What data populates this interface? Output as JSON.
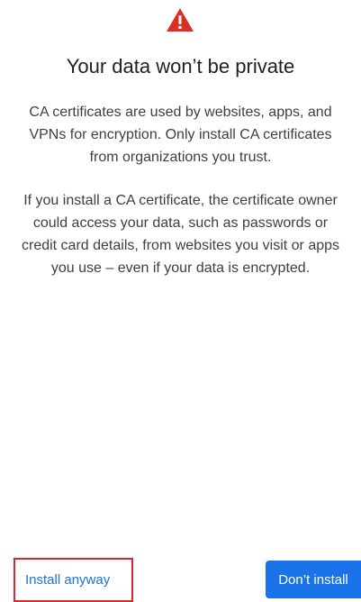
{
  "dialog": {
    "icon": "warning-triangle-icon",
    "title": "Your data won’t be private",
    "paragraph_1": "CA certificates are used by websites, apps, and VPNs for encryption. Only install CA certificates from organizations you trust.",
    "paragraph_2": "If you install a CA certificate, the certificate owner could access your data, such as passwords or credit card details, from websites you visit or apps you use – even if your data is encrypted."
  },
  "actions": {
    "install_anyway": "Install anyway",
    "dont_install": "Don’t install"
  },
  "colors": {
    "warning": "#d93025",
    "primary": "#1a73e8",
    "highlight": "#d9262f"
  }
}
